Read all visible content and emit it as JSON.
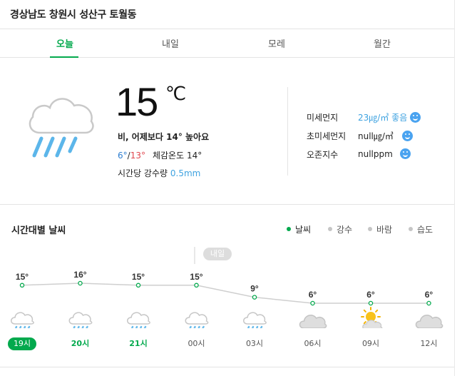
{
  "location": "경상남도 창원시 성산구 토월동",
  "tabs": [
    {
      "label": "오늘",
      "active": true
    },
    {
      "label": "내일",
      "active": false
    },
    {
      "label": "모레",
      "active": false
    },
    {
      "label": "월간",
      "active": false
    }
  ],
  "current": {
    "icon": "rain-cloud-icon",
    "temp": "15",
    "unit": "℃",
    "summary": "비, 어제보다 14° 높아요",
    "min": "6°",
    "slash": "/",
    "max": "13°",
    "feels_like": "체감온도 14°",
    "precip_label": "시간당 강수량",
    "precip_value": "0.5mm"
  },
  "air": [
    {
      "label": "미세먼지",
      "value": "23㎍/㎥",
      "status": "좋음",
      "icon": "smiley-good-icon"
    },
    {
      "label": "초미세먼지",
      "value": "null㎍/㎥",
      "status": "",
      "icon": "smiley-good-icon"
    },
    {
      "label": "오존지수",
      "value": "nullppm",
      "status": "",
      "icon": "smiley-good-icon"
    }
  ],
  "hourly": {
    "title": "시간대별 날씨",
    "legend": [
      {
        "label": "날씨",
        "active": true
      },
      {
        "label": "강수",
        "active": false
      },
      {
        "label": "바람",
        "active": false
      },
      {
        "label": "습도",
        "active": false
      }
    ],
    "tomorrow_marker": "내일",
    "accent_color": "#03a94d",
    "hours": [
      {
        "time": "19시",
        "temp": "15°",
        "icon": "rain-cloud-icon",
        "style": "pill"
      },
      {
        "time": "20시",
        "temp": "16°",
        "icon": "rain-cloud-icon",
        "style": "green"
      },
      {
        "time": "21시",
        "temp": "15°",
        "icon": "rain-cloud-icon",
        "style": "green"
      },
      {
        "time": "00시",
        "temp": "15°",
        "icon": "rain-cloud-icon",
        "style": "normal"
      },
      {
        "time": "03시",
        "temp": "9°",
        "icon": "rain-cloud-icon",
        "style": "normal"
      },
      {
        "time": "06시",
        "temp": "6°",
        "icon": "cloud-icon",
        "style": "normal"
      },
      {
        "time": "09시",
        "temp": "6°",
        "icon": "partly-sunny-icon",
        "style": "normal"
      },
      {
        "time": "12시",
        "temp": "6°",
        "icon": "cloud-icon",
        "style": "normal"
      }
    ]
  }
}
